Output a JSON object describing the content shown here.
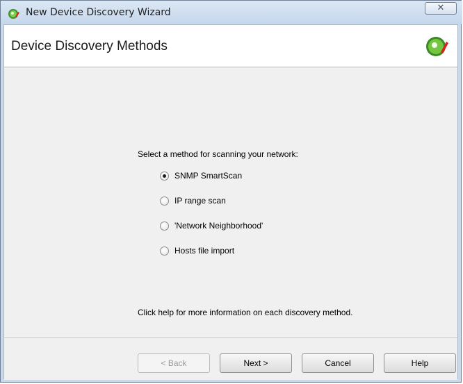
{
  "window": {
    "title": "New Device Discovery Wizard",
    "close_label": "✕"
  },
  "header": {
    "title": "Device Discovery Methods"
  },
  "main": {
    "prompt": "Select a method for scanning your network:",
    "options": [
      {
        "label": "SNMP SmartScan",
        "selected": true
      },
      {
        "label": "IP range scan",
        "selected": false
      },
      {
        "label": "'Network Neighborhood'",
        "selected": false
      },
      {
        "label": "Hosts file import",
        "selected": false
      }
    ],
    "help_text": "Click help for more information on each discovery method."
  },
  "footer": {
    "back_label": "< Back",
    "next_label": "Next >",
    "cancel_label": "Cancel",
    "help_label": "Help"
  },
  "colors": {
    "frame": "#c9d8ea",
    "client": "#f0f0f0",
    "icon_green": "#6fc43a",
    "icon_red": "#e02020"
  }
}
